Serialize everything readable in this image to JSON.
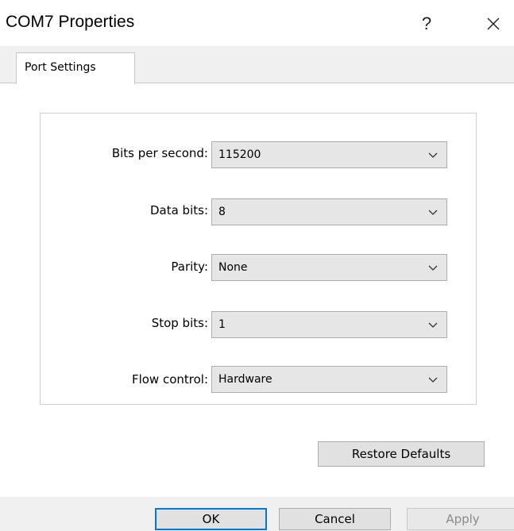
{
  "window": {
    "title": "COM7 Properties",
    "help_glyph": "?"
  },
  "tabs": [
    {
      "label": "Port Settings",
      "selected": true
    }
  ],
  "fields": [
    {
      "label": "Bits per second:",
      "value": "115200"
    },
    {
      "label": "Data bits:",
      "value": "8"
    },
    {
      "label": "Parity:",
      "value": "None"
    },
    {
      "label": "Stop bits:",
      "value": "1"
    },
    {
      "label": "Flow control:",
      "value": "Hardware"
    }
  ],
  "buttons": {
    "restore_defaults": "Restore Defaults",
    "ok": "OK",
    "cancel": "Cancel",
    "apply": "Apply"
  },
  "colors": {
    "focus_border": "#0078d7",
    "disabled_text": "#8a8a8a"
  },
  "icons": {
    "close": "close-icon",
    "help": "help-icon",
    "dropdown": "chevron-down-icon"
  }
}
